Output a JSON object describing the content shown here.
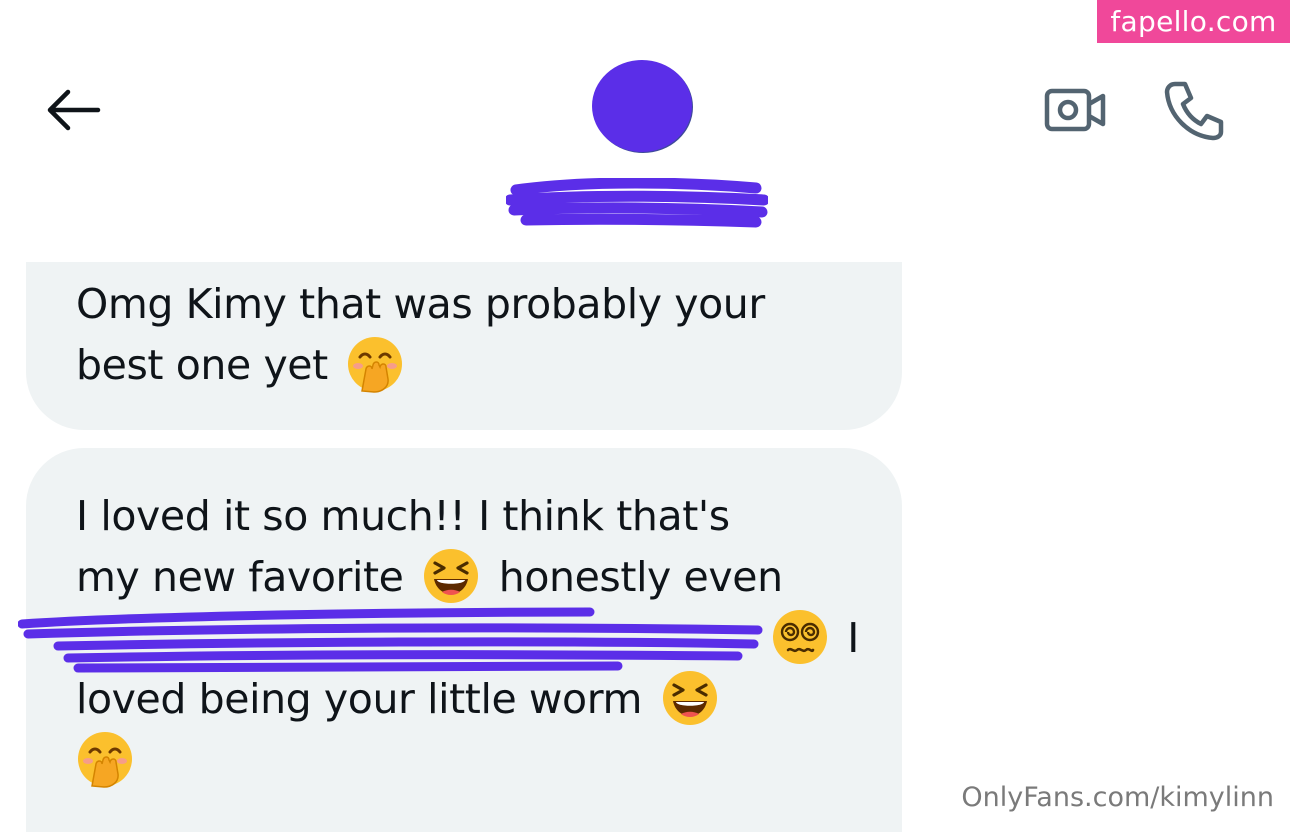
{
  "watermark": {
    "top": "fapello.com",
    "bottom": "OnlyFans.com/kimylinn"
  },
  "header": {
    "back_icon": "arrow-left-icon",
    "video_icon": "video-camera-icon",
    "phone_icon": "phone-icon",
    "avatar_color": "#5b2ee8",
    "redaction_color": "#5b2ee8"
  },
  "messages": [
    {
      "lines": [
        "Omg Kimy that was probably your",
        "best one yet"
      ],
      "emojis": [
        "hand-over-mouth-emoji"
      ]
    },
    {
      "lines": [
        "I loved it so much!! I think that's",
        "my new favorite",
        "honestly even",
        "I",
        "loved being your little worm"
      ],
      "emojis": [
        "grinning-squinting-emoji",
        "dizzy-face-emoji",
        "grinning-squinting-emoji",
        "hand-over-mouth-emoji"
      ]
    }
  ],
  "colors": {
    "bubble": "#eff3f4",
    "text": "#0f1419",
    "icon": "#536471",
    "watermark_bg": "#f0489a"
  }
}
